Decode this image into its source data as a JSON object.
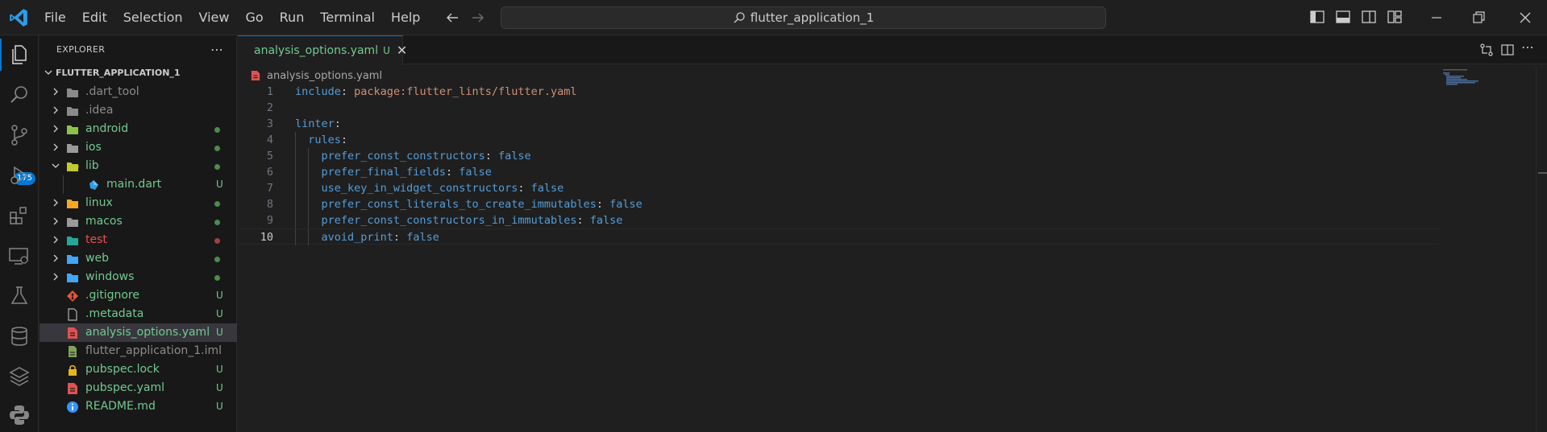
{
  "menu": [
    "File",
    "Edit",
    "Selection",
    "View",
    "Go",
    "Run",
    "Terminal",
    "Help"
  ],
  "search": {
    "text": "flutter_application_1"
  },
  "activity": {
    "scm_badge": "175"
  },
  "explorer": {
    "title": "EXPLORER",
    "project": "FLUTTER_APPLICATION_1",
    "items": [
      {
        "label": ".dart_tool",
        "folder": true,
        "indent": 0,
        "open": false,
        "color": "#8b8b8b",
        "status": "",
        "dot": ""
      },
      {
        "label": ".idea",
        "folder": true,
        "indent": 0,
        "open": false,
        "color": "#8b8b8b",
        "status": "",
        "dot": ""
      },
      {
        "label": "android",
        "folder": true,
        "indent": 0,
        "open": false,
        "color": "#73c991",
        "status": "",
        "dot": "#4f8a4f"
      },
      {
        "label": "ios",
        "folder": true,
        "indent": 0,
        "open": false,
        "color": "#73c991",
        "status": "",
        "dot": "#4f8a4f"
      },
      {
        "label": "lib",
        "folder": true,
        "indent": 0,
        "open": true,
        "color": "#73c991",
        "status": "",
        "dot": "#4f8a4f"
      },
      {
        "label": "main.dart",
        "folder": false,
        "indent": 1,
        "open": false,
        "color": "#73c991",
        "status": "U",
        "dot": ""
      },
      {
        "label": "linux",
        "folder": true,
        "indent": 0,
        "open": false,
        "color": "#73c991",
        "status": "",
        "dot": "#4f8a4f"
      },
      {
        "label": "macos",
        "folder": true,
        "indent": 0,
        "open": false,
        "color": "#73c991",
        "status": "",
        "dot": "#4f8a4f"
      },
      {
        "label": "test",
        "folder": true,
        "indent": 0,
        "open": false,
        "color": "#f14c4c",
        "status": "",
        "dot": "#a1403f"
      },
      {
        "label": "web",
        "folder": true,
        "indent": 0,
        "open": false,
        "color": "#73c991",
        "status": "",
        "dot": "#4f8a4f"
      },
      {
        "label": "windows",
        "folder": true,
        "indent": 0,
        "open": false,
        "color": "#73c991",
        "status": "",
        "dot": "#4f8a4f"
      },
      {
        "label": ".gitignore",
        "folder": false,
        "indent": 0,
        "open": false,
        "color": "#73c991",
        "status": "U",
        "dot": ""
      },
      {
        "label": ".metadata",
        "folder": false,
        "indent": 0,
        "open": false,
        "color": "#73c991",
        "status": "U",
        "dot": ""
      },
      {
        "label": "analysis_options.yaml",
        "folder": false,
        "indent": 0,
        "open": false,
        "color": "#73c991",
        "status": "U",
        "dot": "",
        "selected": true
      },
      {
        "label": "flutter_application_1.iml",
        "folder": false,
        "indent": 0,
        "open": false,
        "color": "#8b8b8b",
        "status": "",
        "dot": ""
      },
      {
        "label": "pubspec.lock",
        "folder": false,
        "indent": 0,
        "open": false,
        "color": "#73c991",
        "status": "U",
        "dot": ""
      },
      {
        "label": "pubspec.yaml",
        "folder": false,
        "indent": 0,
        "open": false,
        "color": "#73c991",
        "status": "U",
        "dot": ""
      },
      {
        "label": "README.md",
        "folder": false,
        "indent": 0,
        "open": false,
        "color": "#73c991",
        "status": "U",
        "dot": ""
      }
    ]
  },
  "tab": {
    "name": "analysis_options.yaml",
    "status": "U"
  },
  "breadcrumb": "analysis_options.yaml",
  "code": [
    {
      "n": "1",
      "parts": [
        [
          "k",
          "include"
        ],
        [
          "p",
          ": "
        ],
        [
          "s",
          "package:flutter_lints/flutter.yaml"
        ]
      ]
    },
    {
      "n": "2",
      "parts": []
    },
    {
      "n": "3",
      "parts": [
        [
          "k",
          "linter"
        ],
        [
          "p",
          ":"
        ]
      ]
    },
    {
      "n": "4",
      "parts": [
        [
          "p",
          "  "
        ],
        [
          "k",
          "rules"
        ],
        [
          "p",
          ":"
        ]
      ]
    },
    {
      "n": "5",
      "parts": [
        [
          "p",
          "    "
        ],
        [
          "k",
          "prefer_const_constructors"
        ],
        [
          "p",
          ": "
        ],
        [
          "b",
          "false"
        ]
      ]
    },
    {
      "n": "6",
      "parts": [
        [
          "p",
          "    "
        ],
        [
          "k",
          "prefer_final_fields"
        ],
        [
          "p",
          ": "
        ],
        [
          "b",
          "false"
        ]
      ]
    },
    {
      "n": "7",
      "parts": [
        [
          "p",
          "    "
        ],
        [
          "k",
          "use_key_in_widget_constructors"
        ],
        [
          "p",
          ": "
        ],
        [
          "b",
          "false"
        ]
      ]
    },
    {
      "n": "8",
      "parts": [
        [
          "p",
          "    "
        ],
        [
          "k",
          "prefer_const_literals_to_create_immutables"
        ],
        [
          "p",
          ": "
        ],
        [
          "b",
          "false"
        ]
      ]
    },
    {
      "n": "9",
      "parts": [
        [
          "p",
          "    "
        ],
        [
          "k",
          "prefer_const_constructors_in_immutables"
        ],
        [
          "p",
          ": "
        ],
        [
          "b",
          "false"
        ]
      ]
    },
    {
      "n": "10",
      "parts": [
        [
          "p",
          "    "
        ],
        [
          "k",
          "avoid_print"
        ],
        [
          "p",
          ": "
        ],
        [
          "b",
          "false"
        ]
      ],
      "current": true
    }
  ]
}
